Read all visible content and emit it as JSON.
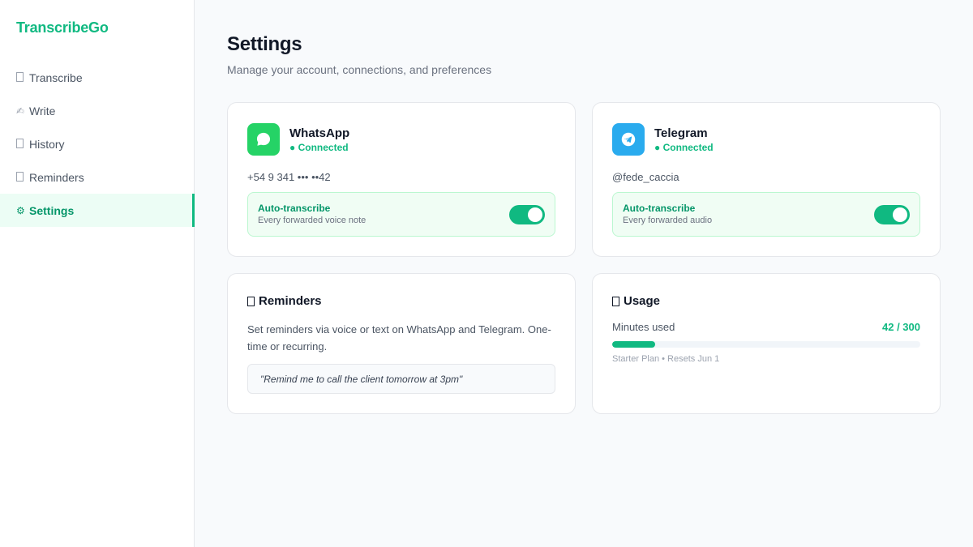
{
  "brand": {
    "name": "TranscribeGo",
    "color": "#10b981"
  },
  "sidebar": {
    "items": [
      {
        "icon": "transcribe-icon",
        "label": "Transcribe",
        "active": false
      },
      {
        "icon": "write-icon",
        "glyph": "✍",
        "label": "Write",
        "active": false
      },
      {
        "icon": "history-icon",
        "label": "History",
        "active": false
      },
      {
        "icon": "reminders-icon",
        "label": "Reminders",
        "active": false
      },
      {
        "icon": "gear-icon",
        "glyph": "⚙",
        "label": "Settings",
        "active": true
      }
    ]
  },
  "page": {
    "title": "Settings",
    "subtitle": "Manage your account, connections, and preferences"
  },
  "whatsapp": {
    "icon": "whatsapp-icon",
    "color": "#25d366",
    "name": "WhatsApp",
    "status": "● Connected",
    "handle": "+54 9 341 ••• ••42",
    "auto_title": "Auto-transcribe",
    "auto_sub": "Every forwarded voice note",
    "auto_enabled": true
  },
  "telegram": {
    "icon": "telegram-icon",
    "color": "#2aabee",
    "name": "Telegram",
    "status": "● Connected",
    "handle": "@fede_caccia",
    "auto_title": "Auto-transcribe",
    "auto_sub": "Every forwarded audio",
    "auto_enabled": true
  },
  "reminders": {
    "icon": "reminders-icon",
    "title": "Reminders",
    "desc": "Set reminders via voice or text on WhatsApp and Telegram. One-time or recurring.",
    "example": "\"Remind me to call the client tomorrow at 3pm\""
  },
  "usage": {
    "icon": "usage-icon",
    "title": "Usage",
    "label": "Minutes used",
    "value_text": "42 / 300",
    "used": 42,
    "limit": 300,
    "plan": "Starter Plan • Resets Jun 1"
  },
  "colors": {
    "accent": "#10b981",
    "accent_dark": "#059669"
  }
}
